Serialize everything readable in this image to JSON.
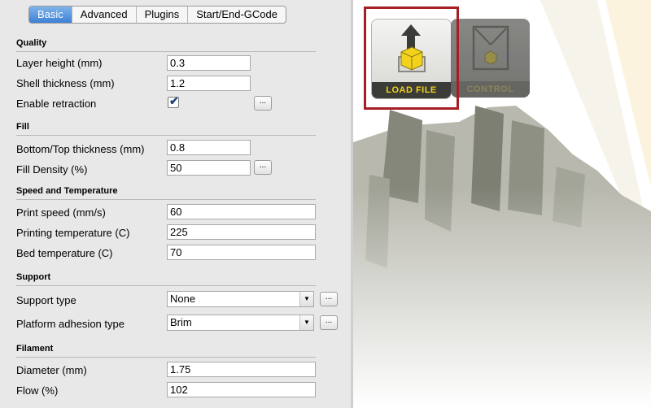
{
  "tabs": [
    "Basic",
    "Advanced",
    "Plugins",
    "Start/End-GCode"
  ],
  "sections": {
    "quality": "Quality",
    "fill": "Fill",
    "speed": "Speed and Temperature",
    "support": "Support",
    "filament": "Filament"
  },
  "fields": {
    "layer_height": {
      "label": "Layer height (mm)",
      "value": "0.3"
    },
    "shell_thickness": {
      "label": "Shell thickness (mm)",
      "value": "1.2"
    },
    "enable_retraction": {
      "label": "Enable retraction",
      "checked": true
    },
    "bottom_top_thickness": {
      "label": "Bottom/Top thickness (mm)",
      "value": "0.8"
    },
    "fill_density": {
      "label": "Fill Density (%)",
      "value": "50"
    },
    "print_speed": {
      "label": "Print speed (mm/s)",
      "value": "60"
    },
    "printing_temperature": {
      "label": "Printing temperature (C)",
      "value": "225"
    },
    "bed_temperature": {
      "label": "Bed temperature (C)",
      "value": "70"
    },
    "support_type": {
      "label": "Support type",
      "value": "None"
    },
    "platform_adhesion": {
      "label": "Platform adhesion type",
      "value": "Brim"
    },
    "diameter": {
      "label": "Diameter (mm)",
      "value": "1.75"
    },
    "flow": {
      "label": "Flow (%)",
      "value": "102"
    }
  },
  "more_button": "...",
  "toolbar": {
    "load_file": "LOAD FILE",
    "control": "CONTROL"
  },
  "colors": {
    "accent_tab": "#4a8ade",
    "highlight_border": "#a61e24",
    "button_yellow": "#f2d21b"
  }
}
